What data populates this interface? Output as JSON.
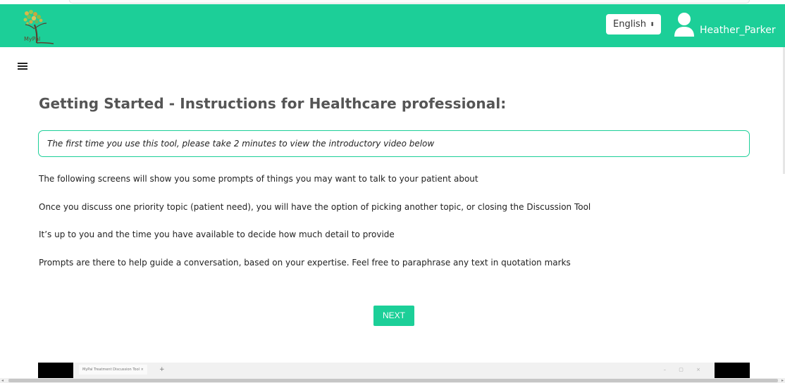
{
  "header": {
    "logo_text": "MyPal",
    "language": "English",
    "language_caret": "⬍",
    "username": "Heather_Parker"
  },
  "main": {
    "title": "Getting Started - Instructions for Healthcare professional:",
    "notice": "The first time you use this tool, please take 2 minutes to view the introductory video below",
    "paragraphs": [
      "The following screens will show you some prompts of things you may want to talk to your patient about",
      "Once you discuss one priority topic (patient need), you will have the option of picking another topic, or closing the Discussion Tool",
      "It’s up to you and the time you have available to decide how much detail to provide",
      "Prompts are there to help guide a conversation, based on your expertise. Feel free to paraphrase any text in quotation marks"
    ],
    "next_label": "NEXT"
  },
  "video": {
    "tab_title": "MyPal Treatment Discussion Tool  ×",
    "plus": "+",
    "controls": "–  ▢  ×"
  },
  "colors": {
    "accent": "#1ccf98",
    "title": "#555555"
  }
}
